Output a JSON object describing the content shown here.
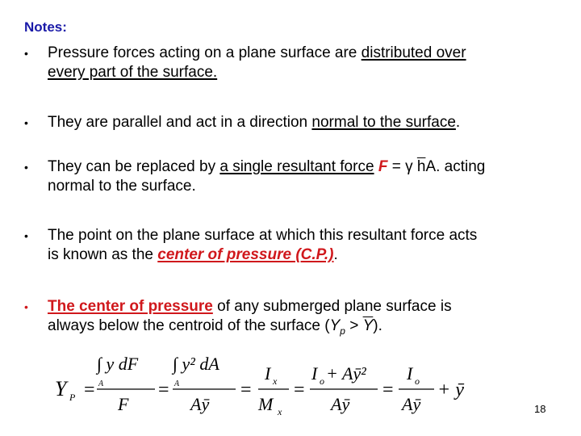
{
  "heading": "Notes:",
  "colors": {
    "heading": "#1a1aa8",
    "accent_red": "#d0181c",
    "text": "#000000",
    "background": "#ffffff"
  },
  "bullets": [
    {
      "line1_a": "Pressure forces acting on a plane surface are ",
      "line1_u": "distributed over",
      "line2_u": "every part of the surface."
    },
    {
      "a": "They are parallel and act in a direction ",
      "u": "normal to the surface",
      "b": "."
    },
    {
      "line1_a": "They can be replaced by ",
      "line1_u": "a single resultant force",
      "F": "F",
      "eq": " = γ ",
      "h": "h",
      "rest": "A. acting",
      "line2": "normal to the surface."
    },
    {
      "line1": "The point on the plane surface at which this resultant force acts",
      "line2_a": "is known as the ",
      "line2_red": "center of pressure (C.P.)",
      "line2_b": "."
    },
    {
      "line1_red": "The center of pressure",
      "line1_b": " of any submerged plane surface is",
      "line2_a": "always below the centroid of the surface (",
      "Y": "Y",
      "p": "p",
      "gt": " > ",
      "Ybar": "Y",
      "line2_b": ")."
    }
  ],
  "equation": {
    "lhs": "Y",
    "lhs_sub": "P",
    "t1_num": "∫ y dF",
    "t1_sub": "A",
    "t1_den": "F",
    "t2_num": "∫ y² dA",
    "t2_sub": "A",
    "t2_den": "Aȳ",
    "t3_num": "I",
    "t3_num_sub": "x",
    "t3_den": "M",
    "t3_den_sub": "x",
    "t4_num": "I",
    "t4_num_sub": "o",
    "t4_num_rest": " + Aȳ²",
    "t4_den": "Aȳ",
    "t5_num": "I",
    "t5_num_sub": "o",
    "t5_den": "Aȳ",
    "t5_rest": "+ ȳ",
    "eq": "="
  },
  "page_number": "18"
}
